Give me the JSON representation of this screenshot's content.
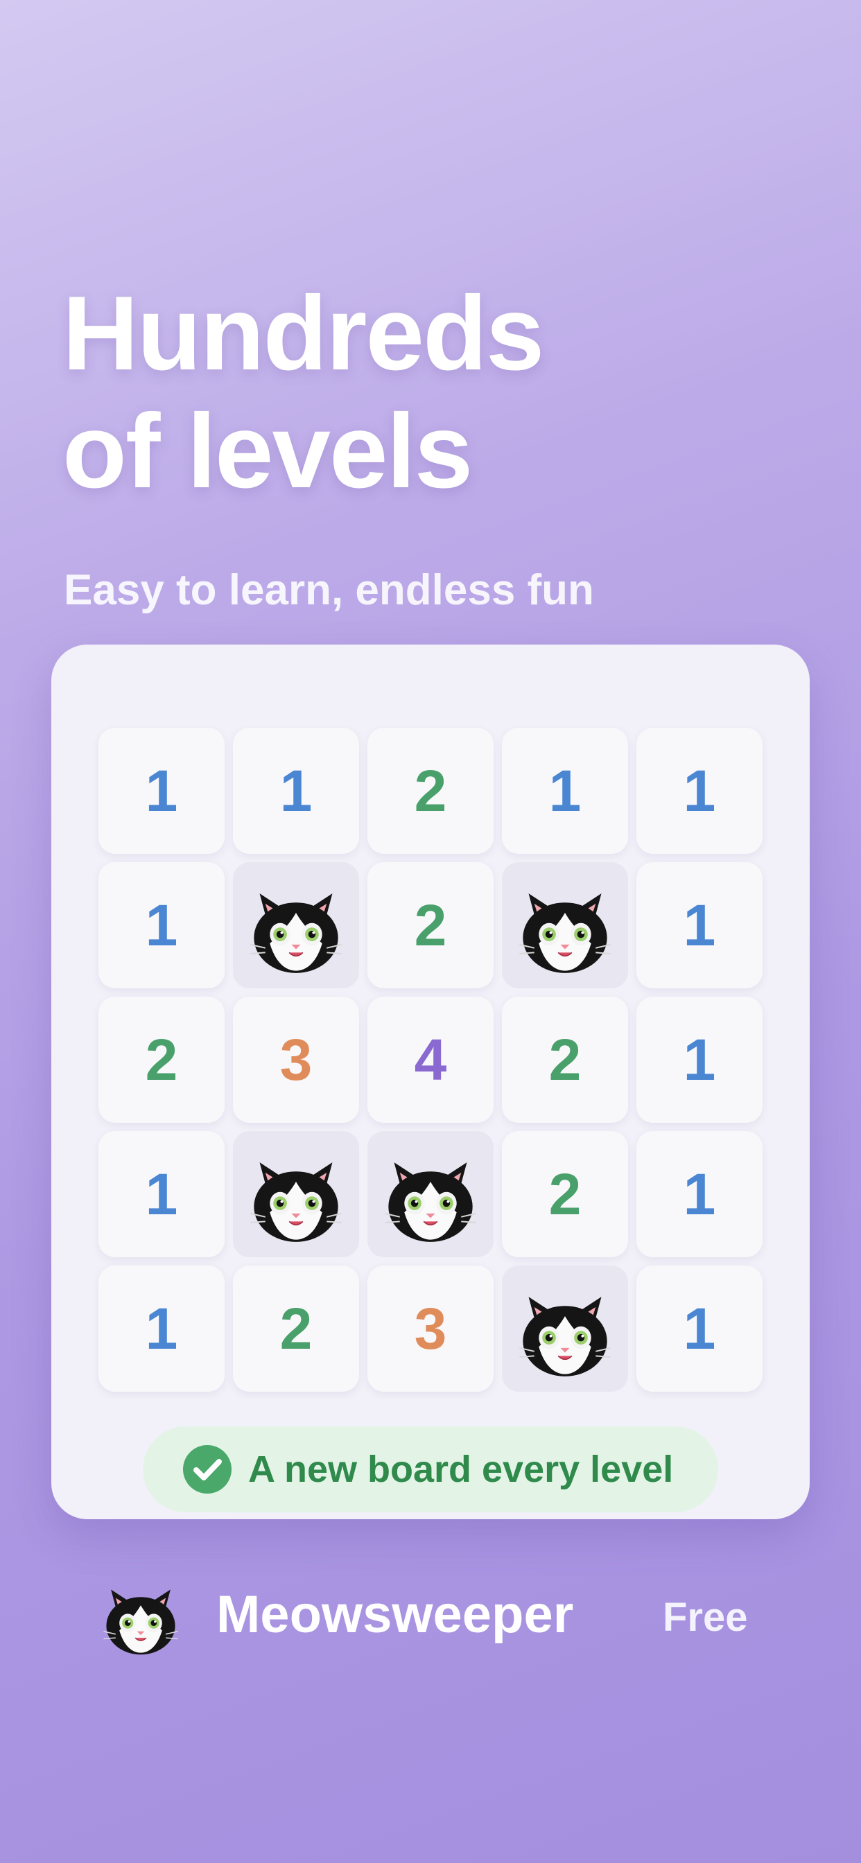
{
  "headline": {
    "line1": "Hundreds",
    "line2": "of levels"
  },
  "subheadline": "Easy to learn, endless fun",
  "board": {
    "rows": [
      [
        "1",
        "1",
        "2",
        "1",
        "1"
      ],
      [
        "1",
        "cat",
        "2",
        "cat",
        "1"
      ],
      [
        "2",
        "3",
        "4",
        "2",
        "1"
      ],
      [
        "1",
        "cat",
        "cat",
        "2",
        "1"
      ],
      [
        "1",
        "2",
        "3",
        "cat",
        "1"
      ]
    ],
    "number_colors": {
      "1": "#4a86d2",
      "2": "#49a06b",
      "3": "#e08c5a",
      "4": "#8a6ad1"
    }
  },
  "badge": {
    "icon": "check-circle-icon",
    "text": "A new board every level",
    "color": "#49a86a"
  },
  "app": {
    "icon": "cat-face-icon",
    "name": "Meowsweeper",
    "price": "Free"
  }
}
